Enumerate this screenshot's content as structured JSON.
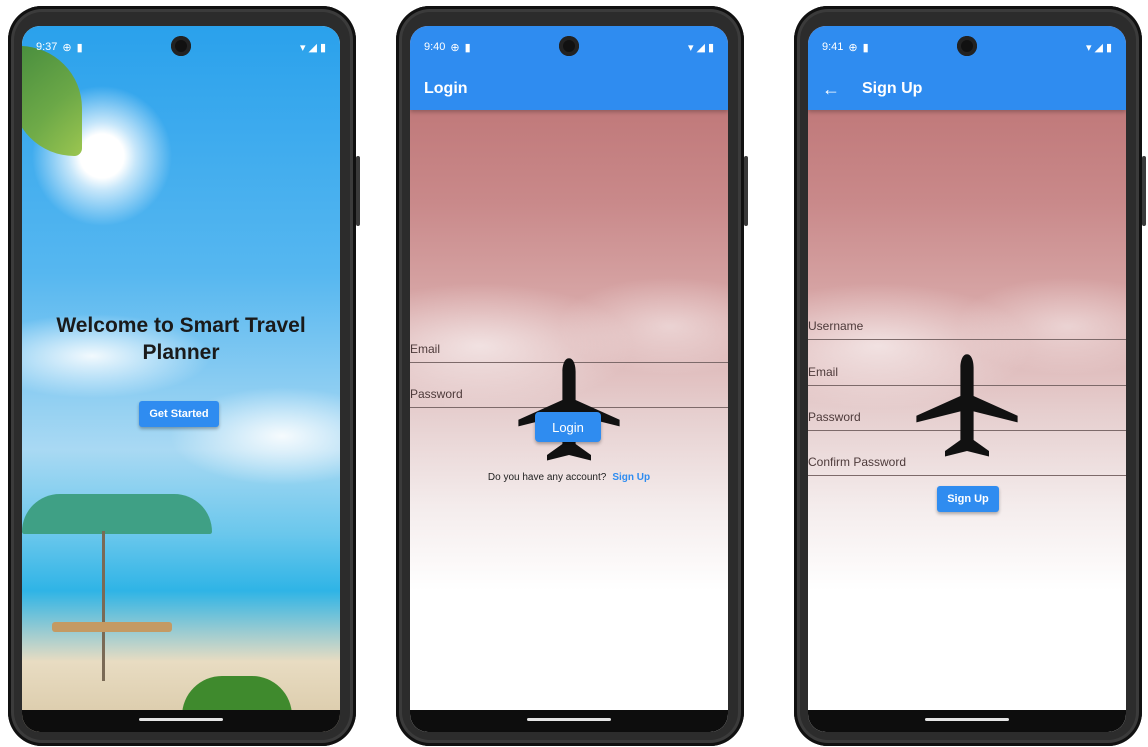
{
  "screen1": {
    "status": {
      "time": "9:37"
    },
    "title": "Welcome to Smart Travel Planner",
    "cta_label": "Get Started"
  },
  "screen2": {
    "status": {
      "time": "9:40"
    },
    "appbar_title": "Login",
    "email_label": "Email",
    "password_label": "Password",
    "login_label": "Login",
    "account_prompt": "Do you have any account?",
    "signup_link": "Sign Up"
  },
  "screen3": {
    "status": {
      "time": "9:41"
    },
    "appbar_title": "Sign Up",
    "username_label": "Username",
    "email_label": "Email",
    "password_label": "Password",
    "confirm_password_label": "Confirm Password",
    "signup_label": "Sign Up"
  },
  "colors": {
    "primary": "#2f8cf0",
    "navbar": "#0d0d0d"
  },
  "icons": [
    "vpn-icon",
    "sim-icon",
    "wifi-icon",
    "signal-icon",
    "battery-icon",
    "back-arrow-icon",
    "airplane-icon"
  ]
}
